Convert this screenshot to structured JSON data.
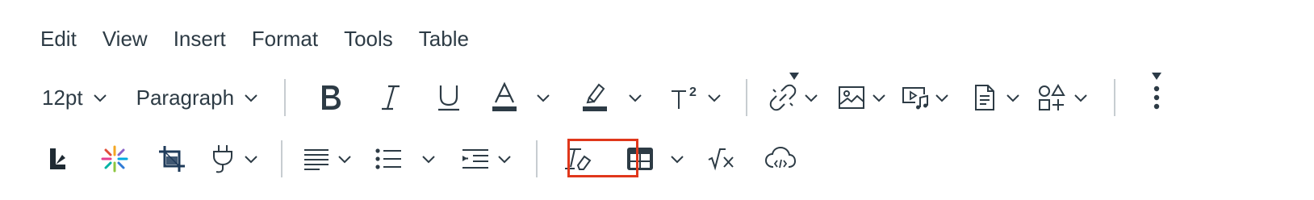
{
  "menu": {
    "edit": "Edit",
    "view": "View",
    "insert": "Insert",
    "format": "Format",
    "tools": "Tools",
    "table": "Table"
  },
  "toolbar": {
    "font_size": "12pt",
    "block_format": "Paragraph",
    "superscript_label": "T²"
  },
  "icons": {
    "bold": "bold-icon",
    "italic": "italic-icon",
    "underline": "underline-icon",
    "text_color": "text-color-icon",
    "highlight": "highlight-icon",
    "superscript": "superscript-icon",
    "link": "link-icon",
    "image": "image-icon",
    "media": "media-icon",
    "document": "document-icon",
    "apps": "apps-icon",
    "more": "more-vertical-icon",
    "lti": "lti-logo-icon",
    "sparkle": "sparkle-icon",
    "crop": "crop-icon",
    "plugin": "plug-icon",
    "align": "align-left-icon",
    "list": "bullet-list-icon",
    "indent": "indent-icon",
    "clear_format": "clear-formatting-icon",
    "table": "table-icon",
    "equation": "equation-icon",
    "cloud": "cloud-embed-icon"
  },
  "colors": {
    "text": "#2d3b45",
    "highlight_border": "#e0371b",
    "separator": "#c7cdd1"
  }
}
